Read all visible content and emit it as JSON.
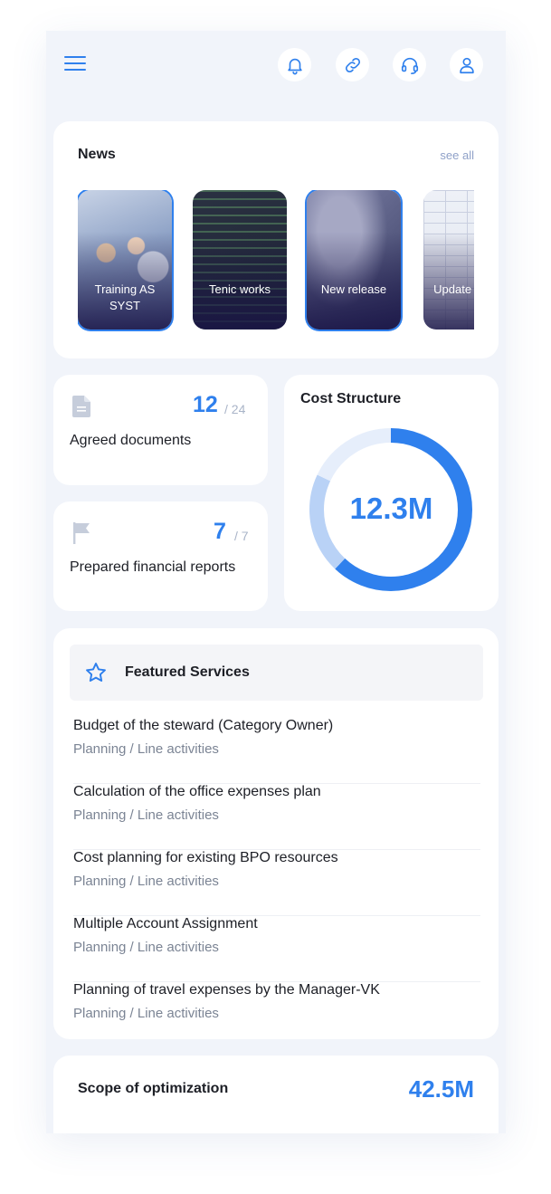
{
  "news": {
    "title": "News",
    "see_all": "see all",
    "items": [
      {
        "label": "Training AS SYST"
      },
      {
        "label": "Tenic works"
      },
      {
        "label": "New release"
      },
      {
        "label": "Update CUBE"
      }
    ]
  },
  "stats": {
    "agreed": {
      "value": "12",
      "total": "/ 24",
      "label": "Agreed documents"
    },
    "reports": {
      "value": "7",
      "total": "/ 7",
      "label": "Prepared financial reports"
    }
  },
  "cost_structure": {
    "title": "Cost Structure",
    "value": "12.3M",
    "segments": [
      {
        "share": 0.62,
        "color": "#2f80ed"
      },
      {
        "share": 0.2,
        "color": "#b9d2f6"
      },
      {
        "share": 0.18,
        "color": "#e6eefb"
      }
    ]
  },
  "featured": {
    "title": "Featured Services",
    "items": [
      {
        "title": "Budget of the steward (Category Owner)",
        "sub": "Planning / Line activities"
      },
      {
        "title": "Calculation of the office expenses plan",
        "sub": "Planning / Line activities"
      },
      {
        "title": "Cost planning for existing BPO resources",
        "sub": "Planning / Line activities"
      },
      {
        "title": "Multiple Account Assignment",
        "sub": "Planning / Line activities"
      },
      {
        "title": "Planning of travel expenses by the Manager-VK",
        "sub": "Planning / Line activities"
      }
    ]
  },
  "scope": {
    "title": "Scope of optimization",
    "value": "42.5M"
  },
  "icons": {
    "menu": "hamburger-icon",
    "bell": "bell-icon",
    "link": "link-icon",
    "support": "headset-icon",
    "user": "user-icon",
    "document": "document-icon",
    "flag": "flag-icon",
    "star": "star-icon"
  },
  "colors": {
    "accent": "#2f80ed",
    "background": "#f1f4fa",
    "muted": "#7b8494"
  }
}
